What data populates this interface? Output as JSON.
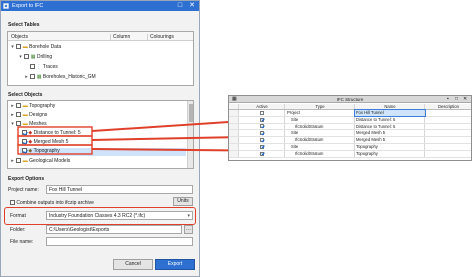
{
  "dialog": {
    "title": "Export to IFC",
    "select_tables_label": "Select Tables",
    "tables_columns": [
      "Objects",
      "Column",
      "Colourings"
    ],
    "tables_tree": [
      {
        "label": "Borehole Data",
        "level": 0,
        "checked": false,
        "expander": "▾"
      },
      {
        "label": "Drilling",
        "level": 1,
        "checked": false,
        "expander": "▾"
      },
      {
        "label": "Traces",
        "level": 2,
        "checked": false,
        "expander": ""
      },
      {
        "label": "Boreholes_Historic_GM",
        "level": 2,
        "checked": false,
        "expander": "▸"
      }
    ],
    "select_objects_label": "Select Objects",
    "objects_tree": [
      {
        "label": "Topography",
        "level": 0,
        "checked": false,
        "expander": "▸"
      },
      {
        "label": "Designs",
        "level": 0,
        "checked": false,
        "expander": "▸"
      },
      {
        "label": "Meshes",
        "level": 0,
        "checked": false,
        "expander": "▾"
      },
      {
        "label": "Distance to Tunnel: 5",
        "level": 1,
        "checked": true,
        "expander": ""
      },
      {
        "label": "Merged Mesh 5",
        "level": 1,
        "checked": true,
        "expander": ""
      },
      {
        "label": "Topography",
        "level": 1,
        "checked": true,
        "expander": "",
        "selected": true
      },
      {
        "label": "Geological Models",
        "level": 0,
        "checked": false,
        "expander": "▸"
      }
    ],
    "export_options_label": "Export Options",
    "project_name_label": "Project name:",
    "project_name_value": "Fox Hill Tunnel",
    "units_button": "Units",
    "combine_label": "Combine outputs into ifczip archive",
    "format_label": "Format",
    "format_value": "Industry Foundation Classes 4.3 RC2 (*.ifc)",
    "folder_label": "Folder:",
    "folder_value": "C:\\Users\\Geologist\\Exports",
    "file_name_label": "File name:",
    "file_name_value": "",
    "cancel_button": "Cancel",
    "export_button": "Export"
  },
  "ifc_panel": {
    "title": "IFC Structure",
    "columns": [
      "Active",
      "Type",
      "Name",
      "Description"
    ],
    "rows": [
      {
        "active": false,
        "indent": 0,
        "type": "Project",
        "name": "Fox Hill Tunnel",
        "editing": true
      },
      {
        "active": true,
        "indent": 1,
        "type": "Site",
        "name": "Distance to Tunnel: 5",
        "editing": false
      },
      {
        "active": true,
        "indent": 2,
        "type": "IfcSolidStratum",
        "name": "Distance to Tunnel: 5",
        "editing": false
      },
      {
        "active": true,
        "indent": 1,
        "type": "Site",
        "name": "Merged Mesh 5",
        "editing": false
      },
      {
        "active": true,
        "indent": 2,
        "type": "IfcSolidStratum",
        "name": "Merged Mesh 5",
        "editing": false
      },
      {
        "active": true,
        "indent": 1,
        "type": "Site",
        "name": "Topography",
        "editing": false
      },
      {
        "active": true,
        "indent": 2,
        "type": "IfcSolidStratum",
        "name": "Topography",
        "editing": false
      }
    ]
  },
  "colors": {
    "titlebar": "#2e6fd2",
    "highlight": "#e0402a",
    "selection": "#cfe4fb"
  }
}
